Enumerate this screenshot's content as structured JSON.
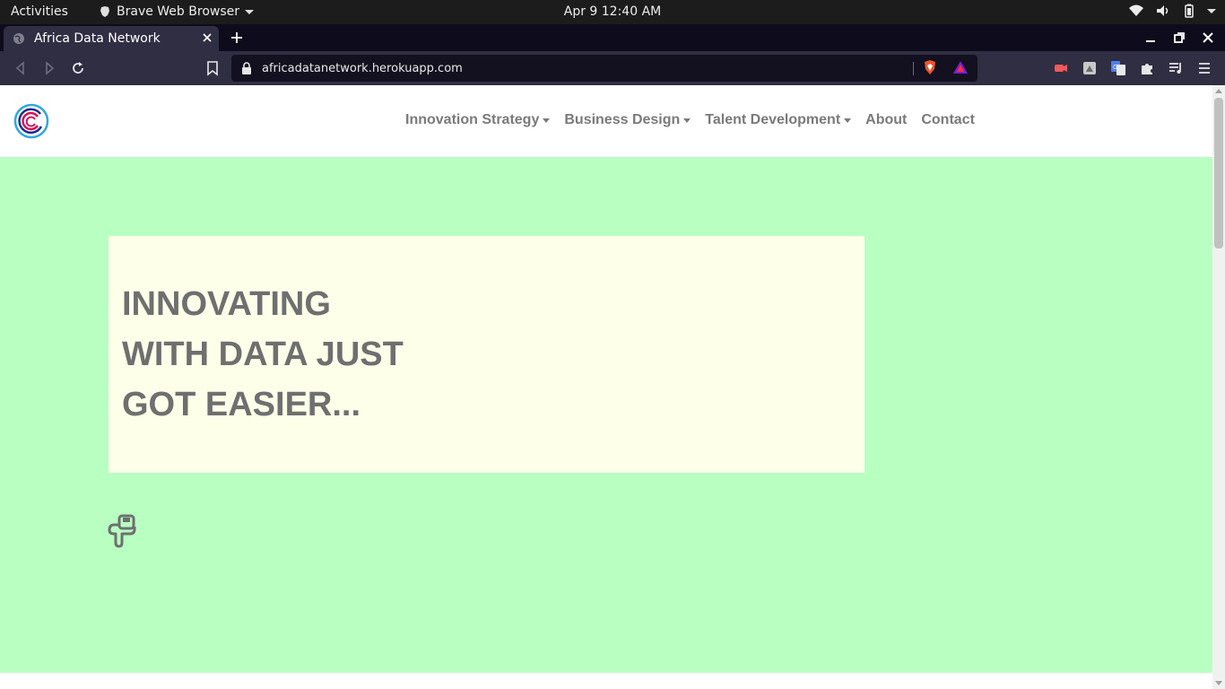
{
  "system_bar": {
    "activities": "Activities",
    "app_name": "Brave Web Browser",
    "clock": "Apr 9  12:40 AM"
  },
  "browser": {
    "tab_title": "Africa Data Network",
    "url": "africadatanetwork.herokuapp.com"
  },
  "site": {
    "nav": [
      {
        "label": "Innovation Strategy",
        "dropdown": true
      },
      {
        "label": "Business Design",
        "dropdown": true
      },
      {
        "label": "Talent Development",
        "dropdown": true
      },
      {
        "label": "About",
        "dropdown": false
      },
      {
        "label": "Contact",
        "dropdown": false
      }
    ],
    "hero": {
      "line1": "INNOVATING",
      "line2": "WITH DATA JUST",
      "line3": "GOT EASIER..."
    }
  },
  "colors": {
    "hero_bg": "#b8ffc2",
    "card_bg": "#fdffe9",
    "text_gray": "#6f6f6f"
  }
}
